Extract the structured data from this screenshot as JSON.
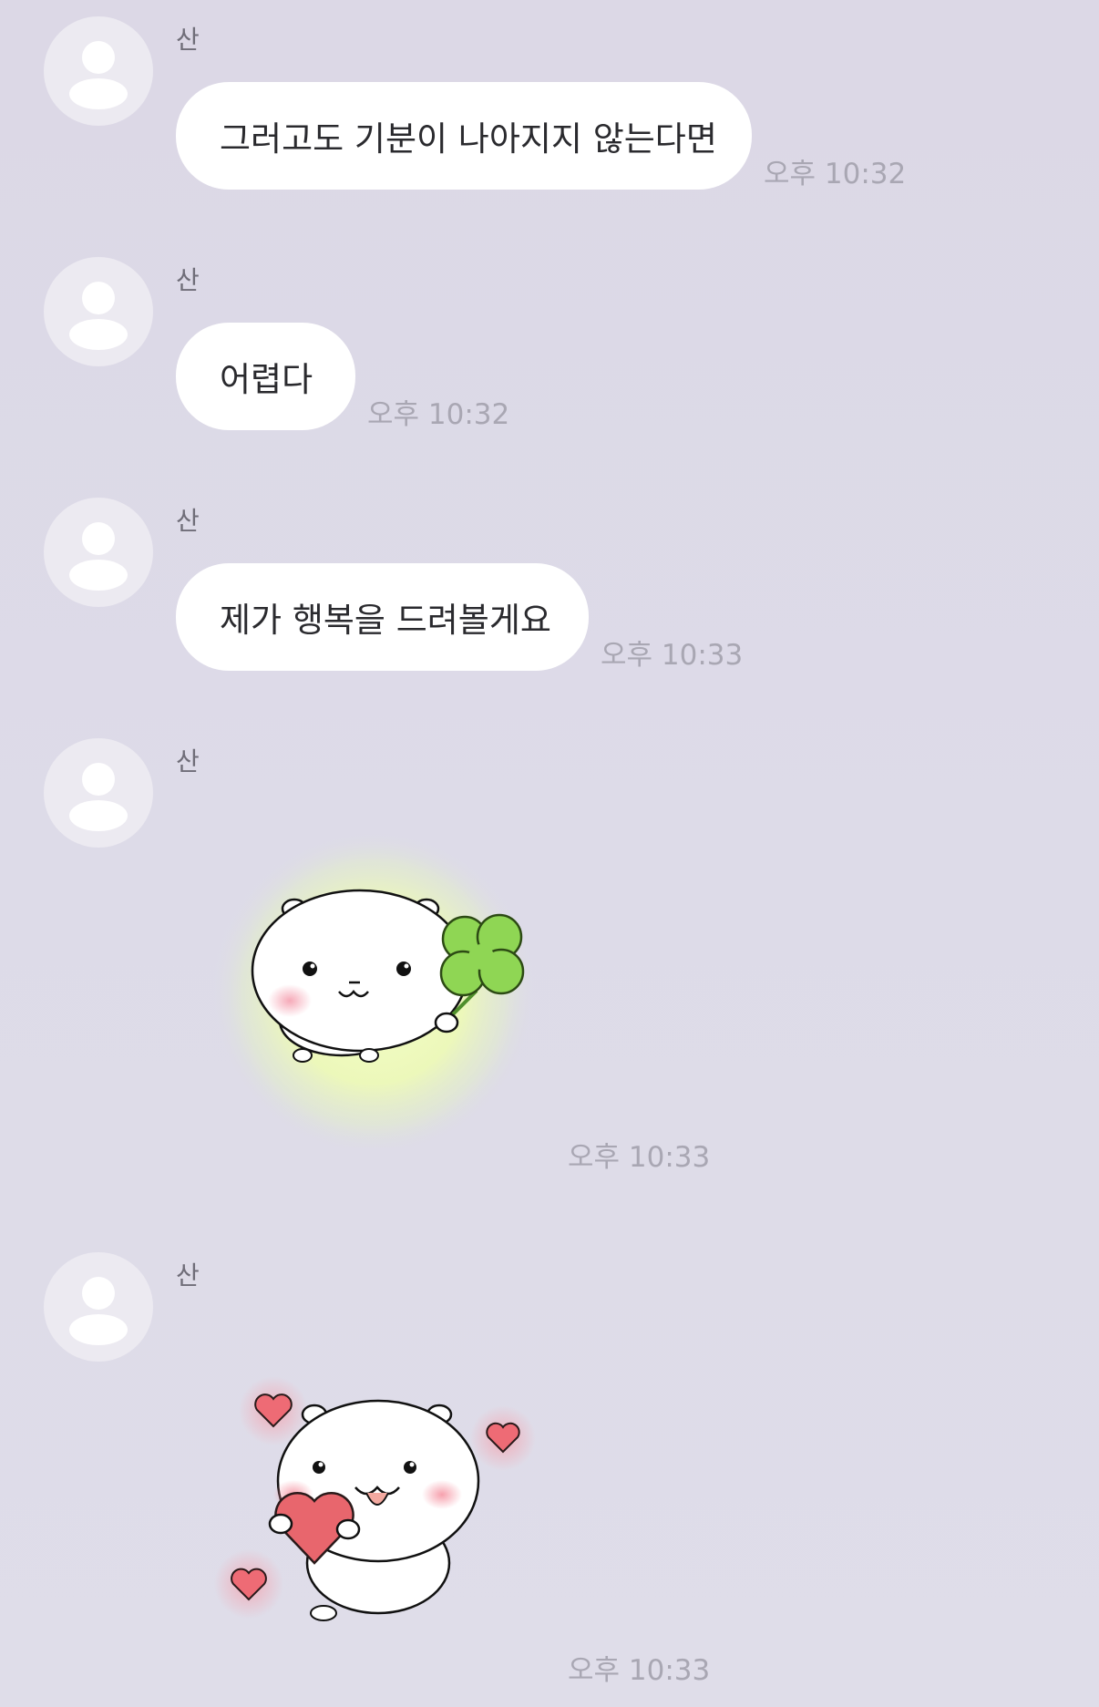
{
  "colors": {
    "background": "#dddbe8",
    "bubble": "#ffffff",
    "text": "#2a2a2e",
    "sender": "#6f6d78",
    "time": "#a9a7b3",
    "avatar": "#eceaf1"
  },
  "messages": [
    {
      "sender": "산",
      "text": "그러고도 기분이 나아지지 않는다면",
      "time": "오후 10:32"
    },
    {
      "sender": "산",
      "text": "어렵다",
      "time": "오후 10:32"
    },
    {
      "sender": "산",
      "text": "제가 행복을 드려볼게요",
      "time": "오후 10:33"
    },
    {
      "sender": "산",
      "sticker": "hamster-holding-clover-sticker",
      "time": "오후 10:33"
    },
    {
      "sender": "산",
      "sticker": "hamster-holding-heart-sticker",
      "time": "오후 10:33"
    }
  ]
}
